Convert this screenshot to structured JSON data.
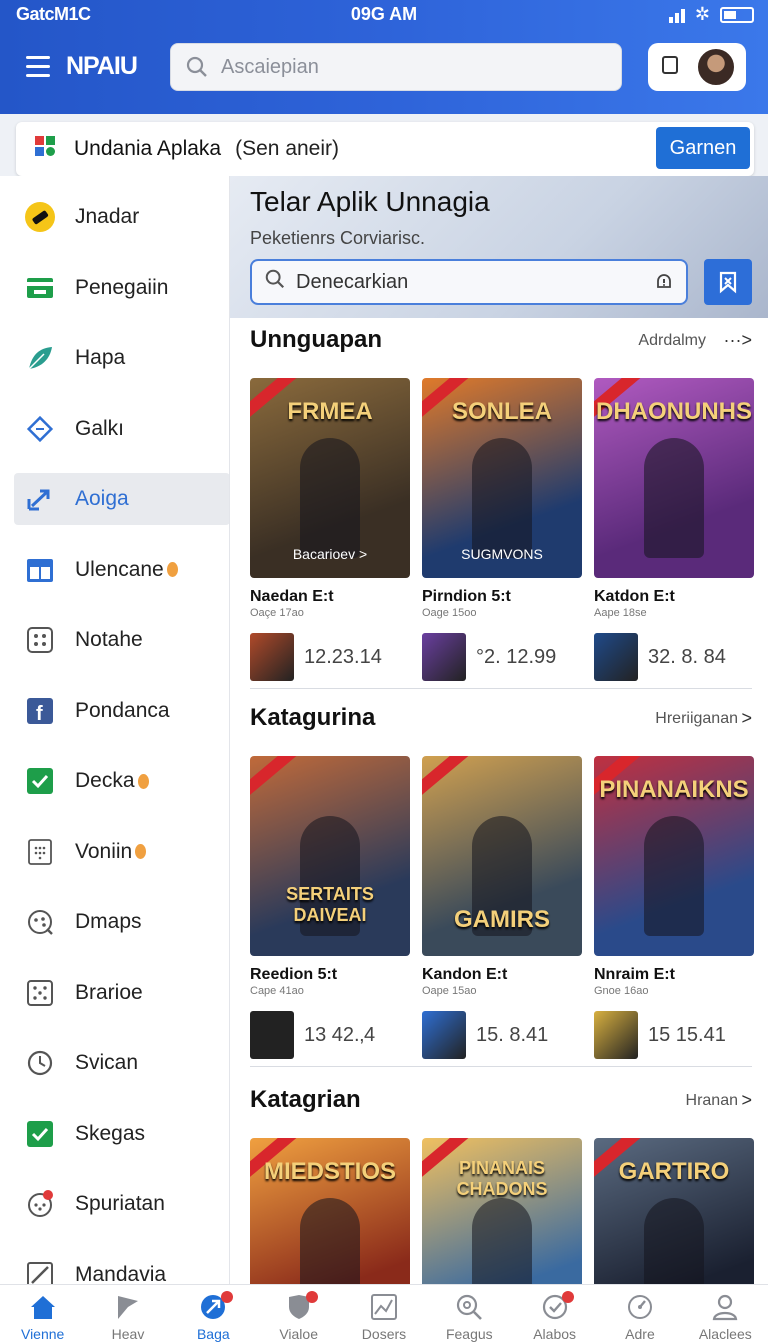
{
  "status_bar": {
    "carrier": "GatcM1C",
    "time": "09G AM"
  },
  "header": {
    "brand": "NPAIU",
    "search_placeholder": "Ascaiepian"
  },
  "notice": {
    "label": "Undania Aplaka",
    "sub": "(Sen aneir)",
    "button": "Garnen"
  },
  "sidebar": {
    "items": [
      {
        "label": "Jnadar",
        "icon": "ticket-icon",
        "color": "#f5c518"
      },
      {
        "label": "Penegaiin",
        "icon": "card-icon",
        "color": "#1e9e4a"
      },
      {
        "label": "Hapa",
        "icon": "leaf-icon",
        "color": "#2a9d8f"
      },
      {
        "label": "Galkı",
        "icon": "tag-icon",
        "color": "#2f6fd3"
      },
      {
        "label": "Aoiga",
        "icon": "trend-arrow-icon",
        "color": "#2f6fd3",
        "active": true
      },
      {
        "label": "Ulencane",
        "icon": "calendar-icon",
        "color": "#2f6fd3",
        "dot": true
      },
      {
        "label": "Notahe",
        "icon": "grid-icon",
        "color": "#555555"
      },
      {
        "label": "Pondanca",
        "icon": "facebook-icon",
        "color": "#3b5998"
      },
      {
        "label": "Decka",
        "icon": "check-box-icon",
        "color": "#1e9e4a",
        "dot": true
      },
      {
        "label": "Voniin",
        "icon": "dotted-box-icon",
        "color": "#555555",
        "dot": true
      },
      {
        "label": "Dmaps",
        "icon": "gamepad-icon",
        "color": "#555555"
      },
      {
        "label": "Brarioe",
        "icon": "dice-icon",
        "color": "#555555"
      },
      {
        "label": "Svican",
        "icon": "clock-icon",
        "color": "#555555"
      },
      {
        "label": "Skegas",
        "icon": "check-box-icon",
        "color": "#1e9e4a"
      },
      {
        "label": "Spuriatan",
        "icon": "controller-badge-icon",
        "color": "#555555"
      },
      {
        "label": "Mandavia",
        "icon": "pencil-box-icon",
        "color": "#555555"
      }
    ]
  },
  "hero": {
    "title": "Telar Aplik Unnagia",
    "subtitle": "Peketienrs Corviarisc.",
    "search_value": "Denecarkian"
  },
  "sections": [
    {
      "title": "Unnguapan",
      "link": "Adrdalmy",
      "more": "···>",
      "cards": [
        {
          "cover_title": "FRMEA",
          "cover_sub": "Bacarioev >",
          "name": "Naedan E:t",
          "meta": "Oaçe 17ao",
          "price": "12.23.14",
          "colors": [
            "#3a2f24",
            "#8a6a3c"
          ],
          "thumb": "#b04a2a"
        },
        {
          "cover_title": "SONLEA",
          "cover_sub": "SUGMVONS",
          "name": "Pirndion 5:t",
          "meta": "Oage 15oo",
          "price": "°2. 12.99",
          "colors": [
            "#1f3b6e",
            "#e07a2a"
          ],
          "thumb": "#6a3fa0"
        },
        {
          "cover_title": "DHAONUNHS",
          "cover_sub": "",
          "name": "Katdon E:t",
          "meta": "Aape 18se",
          "price": "32. 8. 84",
          "colors": [
            "#5a2a7a",
            "#b05ac0"
          ],
          "thumb": "#1f4a8a"
        }
      ]
    },
    {
      "title": "Katagurina",
      "link": "Hreriiganan",
      "more": ">",
      "cards": [
        {
          "cover_title": "SERTAITS DAIVEAI",
          "cover_sub": "",
          "name": "Reedion 5:t",
          "meta": "Cape 41ao",
          "price": "13 42.‚4",
          "colors": [
            "#2a3a5a",
            "#c06a3a"
          ],
          "thumb": "#222222"
        },
        {
          "cover_title": "GAMIRS",
          "cover_sub": "",
          "name": "Kandon E:t",
          "meta": "Oape 15ao",
          "price": "15. 8.41",
          "colors": [
            "#3a4a5a",
            "#d0a050"
          ],
          "thumb": "#2f6fd3"
        },
        {
          "cover_title": "PINANAIKNS",
          "cover_sub": "",
          "name": "Nnraim E:t",
          "meta": "Gnoe 16ao",
          "price": "15 15.41",
          "colors": [
            "#2a4a8a",
            "#c03040"
          ],
          "thumb": "#d8b040"
        }
      ]
    },
    {
      "title": "Katagrian",
      "link": "Hranan",
      "more": ">",
      "cards": [
        {
          "cover_title": "MIEDSTIOS",
          "cover_sub": "",
          "colors": [
            "#8a2a1a",
            "#f0a040"
          ]
        },
        {
          "cover_title": "PINANAIS CHADONS",
          "cover_sub": "",
          "colors": [
            "#3a6aa0",
            "#f0c060"
          ]
        },
        {
          "cover_title": "GARTIRO",
          "cover_sub": "",
          "colors": [
            "#1a2030",
            "#5a6a80"
          ]
        }
      ]
    }
  ],
  "bottom_nav": [
    {
      "label": "Vienne",
      "icon": "home-icon",
      "active": true
    },
    {
      "label": "Heav",
      "icon": "flag-icon"
    },
    {
      "label": "Baga",
      "icon": "rocket-icon",
      "active": true,
      "badge": true
    },
    {
      "label": "Vialoe",
      "icon": "shield-icon",
      "badge": true
    },
    {
      "label": "Dosers",
      "icon": "image-icon"
    },
    {
      "label": "Feagus",
      "icon": "magnifier-gear-icon"
    },
    {
      "label": "Alabos",
      "icon": "check-circle-icon",
      "badge": true
    },
    {
      "label": "Adre",
      "icon": "gauge-icon"
    },
    {
      "label": "Alaclees",
      "icon": "person-icon"
    }
  ]
}
